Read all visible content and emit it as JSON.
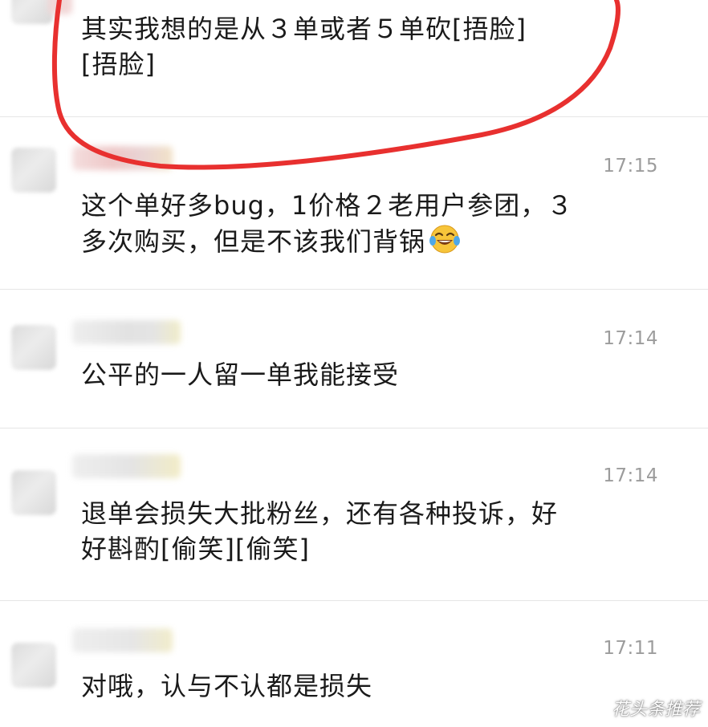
{
  "messages": [
    {
      "time": "",
      "lines": [
        "其实我想的是从３单或者５单砍[捂脸]",
        "[捂脸]"
      ]
    },
    {
      "time": "17:15",
      "lines": [
        "这个单好多bug，1价格２老用户参团，３",
        "多次购买，但是不该我们背锅"
      ],
      "emoji": "laughing-tears-emoji"
    },
    {
      "time": "17:14",
      "lines": [
        "公平的一人留一单我能接受"
      ]
    },
    {
      "time": "17:14",
      "lines": [
        "退单会损失大批粉丝，还有各种投诉，好",
        "好斟酌[偷笑][偷笑]"
      ]
    },
    {
      "time": "17:11",
      "lines": [
        "对哦，认与不认都是损失"
      ]
    }
  ],
  "highlight": {
    "color": "#e8302f"
  },
  "watermark": {
    "text": "花头条推荐",
    "icon": "weibo-icon"
  }
}
